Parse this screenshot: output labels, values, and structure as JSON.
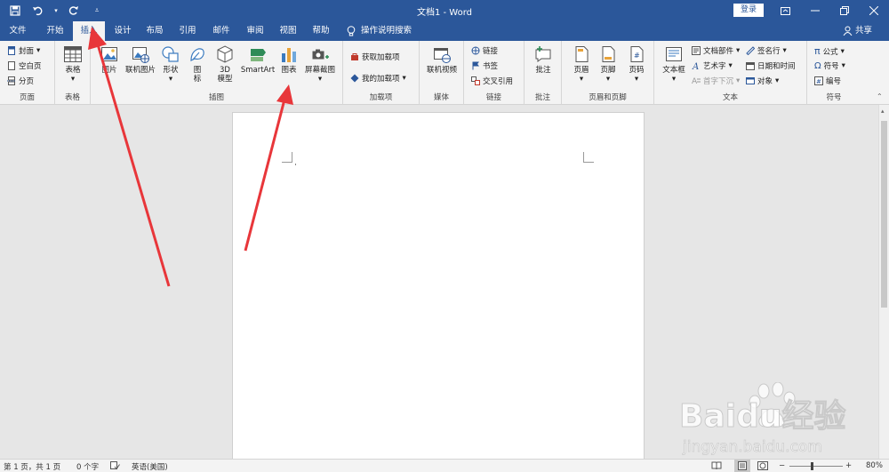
{
  "titlebar": {
    "doc_title": "文档1 - Word",
    "login": "登录"
  },
  "tabs": [
    "文件",
    "开始",
    "插入",
    "设计",
    "布局",
    "引用",
    "邮件",
    "审阅",
    "视图",
    "帮助"
  ],
  "tell_me": "操作说明搜索",
  "share": "共享",
  "ribbon": {
    "pages": {
      "label": "页面",
      "cover": "封面",
      "blank": "空白页",
      "break": "分页"
    },
    "tables": {
      "label": "表格",
      "table": "表格"
    },
    "illustrations": {
      "label": "插图",
      "picture": "图片",
      "online_picture": "联机图片",
      "shapes": "形状",
      "icons_l1": "图",
      "icons_l2": "标",
      "model_l1": "3D",
      "model_l2": "模型",
      "smartart": "SmartArt",
      "chart": "图表",
      "screenshot": "屏幕截图"
    },
    "addins": {
      "label": "加载项",
      "get": "获取加载项",
      "mine": "我的加载项"
    },
    "media": {
      "label": "媒体",
      "video": "联机视频"
    },
    "links": {
      "label": "链接",
      "link": "链接",
      "bookmark": "书签",
      "crossref": "交叉引用"
    },
    "comments": {
      "label": "批注",
      "comment": "批注"
    },
    "header_footer": {
      "label": "页眉和页脚",
      "header": "页眉",
      "footer": "页脚",
      "page_number": "页码"
    },
    "text": {
      "label": "文本",
      "textbox": "文本框",
      "quickparts": "文档部件",
      "wordart": "艺术字",
      "dropcap": "首字下沉",
      "signature": "签名行",
      "datetime": "日期和时间",
      "object": "对象"
    },
    "symbols": {
      "label": "符号",
      "equation": "公式",
      "symbol": "符号",
      "number": "编号"
    }
  },
  "statusbar": {
    "page": "第 1 页，共 1 页",
    "words": "0 个字",
    "language": "英语(美国)",
    "zoom": "80%"
  },
  "watermark": {
    "brand": "Baidu经验",
    "url": "jingyan.baidu.com"
  },
  "colors": {
    "accent": "#2b579a",
    "arrow": "#e8363a"
  }
}
